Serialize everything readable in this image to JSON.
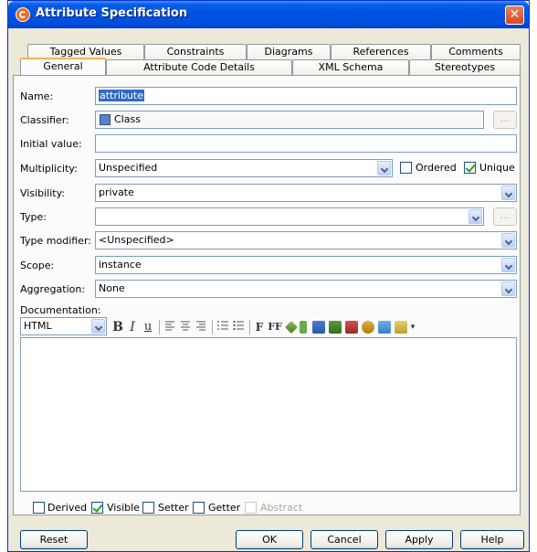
{
  "window": {
    "title": "Attribute Specification",
    "close": "✕"
  },
  "tabs_back": [
    "Tagged Values",
    "Constraints",
    "Diagrams",
    "References",
    "Comments"
  ],
  "tabs_front": [
    "General",
    "Attribute Code Details",
    "XML Schema",
    "Stereotypes"
  ],
  "active_tab": "General",
  "form": {
    "name_label": "Name:",
    "name_value": "attribute",
    "classifier_label": "Classifier:",
    "classifier_value": "Class",
    "initial_label": "Initial value:",
    "initial_value": "",
    "multiplicity_label": "Multiplicity:",
    "multiplicity_value": "Unspecified",
    "ordered_label": "Ordered",
    "ordered_checked": false,
    "unique_label": "Unique",
    "unique_checked": true,
    "visibility_label": "Visibility:",
    "visibility_value": "private",
    "type_label": "Type:",
    "type_value": "",
    "type_modifier_label": "Type modifier:",
    "type_modifier_value": "<Unspecified>",
    "scope_label": "Scope:",
    "scope_value": "instance",
    "aggregation_label": "Aggregation:",
    "aggregation_value": "None",
    "ellipsis": "...",
    "documentation_label": "Documentation:",
    "doc_format": "HTML"
  },
  "toolbar": {
    "bold": "B",
    "italic": "I",
    "underline": "u",
    "font": "F",
    "font_size": "FF"
  },
  "options": {
    "derived": "Derived",
    "visible": "Visible",
    "setter": "Setter",
    "getter": "Getter",
    "abstract": "Abstract"
  },
  "buttons": {
    "reset": "Reset",
    "ok": "OK",
    "cancel": "Cancel",
    "apply": "Apply",
    "help": "Help"
  },
  "colors": {
    "title_bar": "#0054e3",
    "selection": "#316ac5",
    "active_tab_accent": "#f7b64a"
  }
}
